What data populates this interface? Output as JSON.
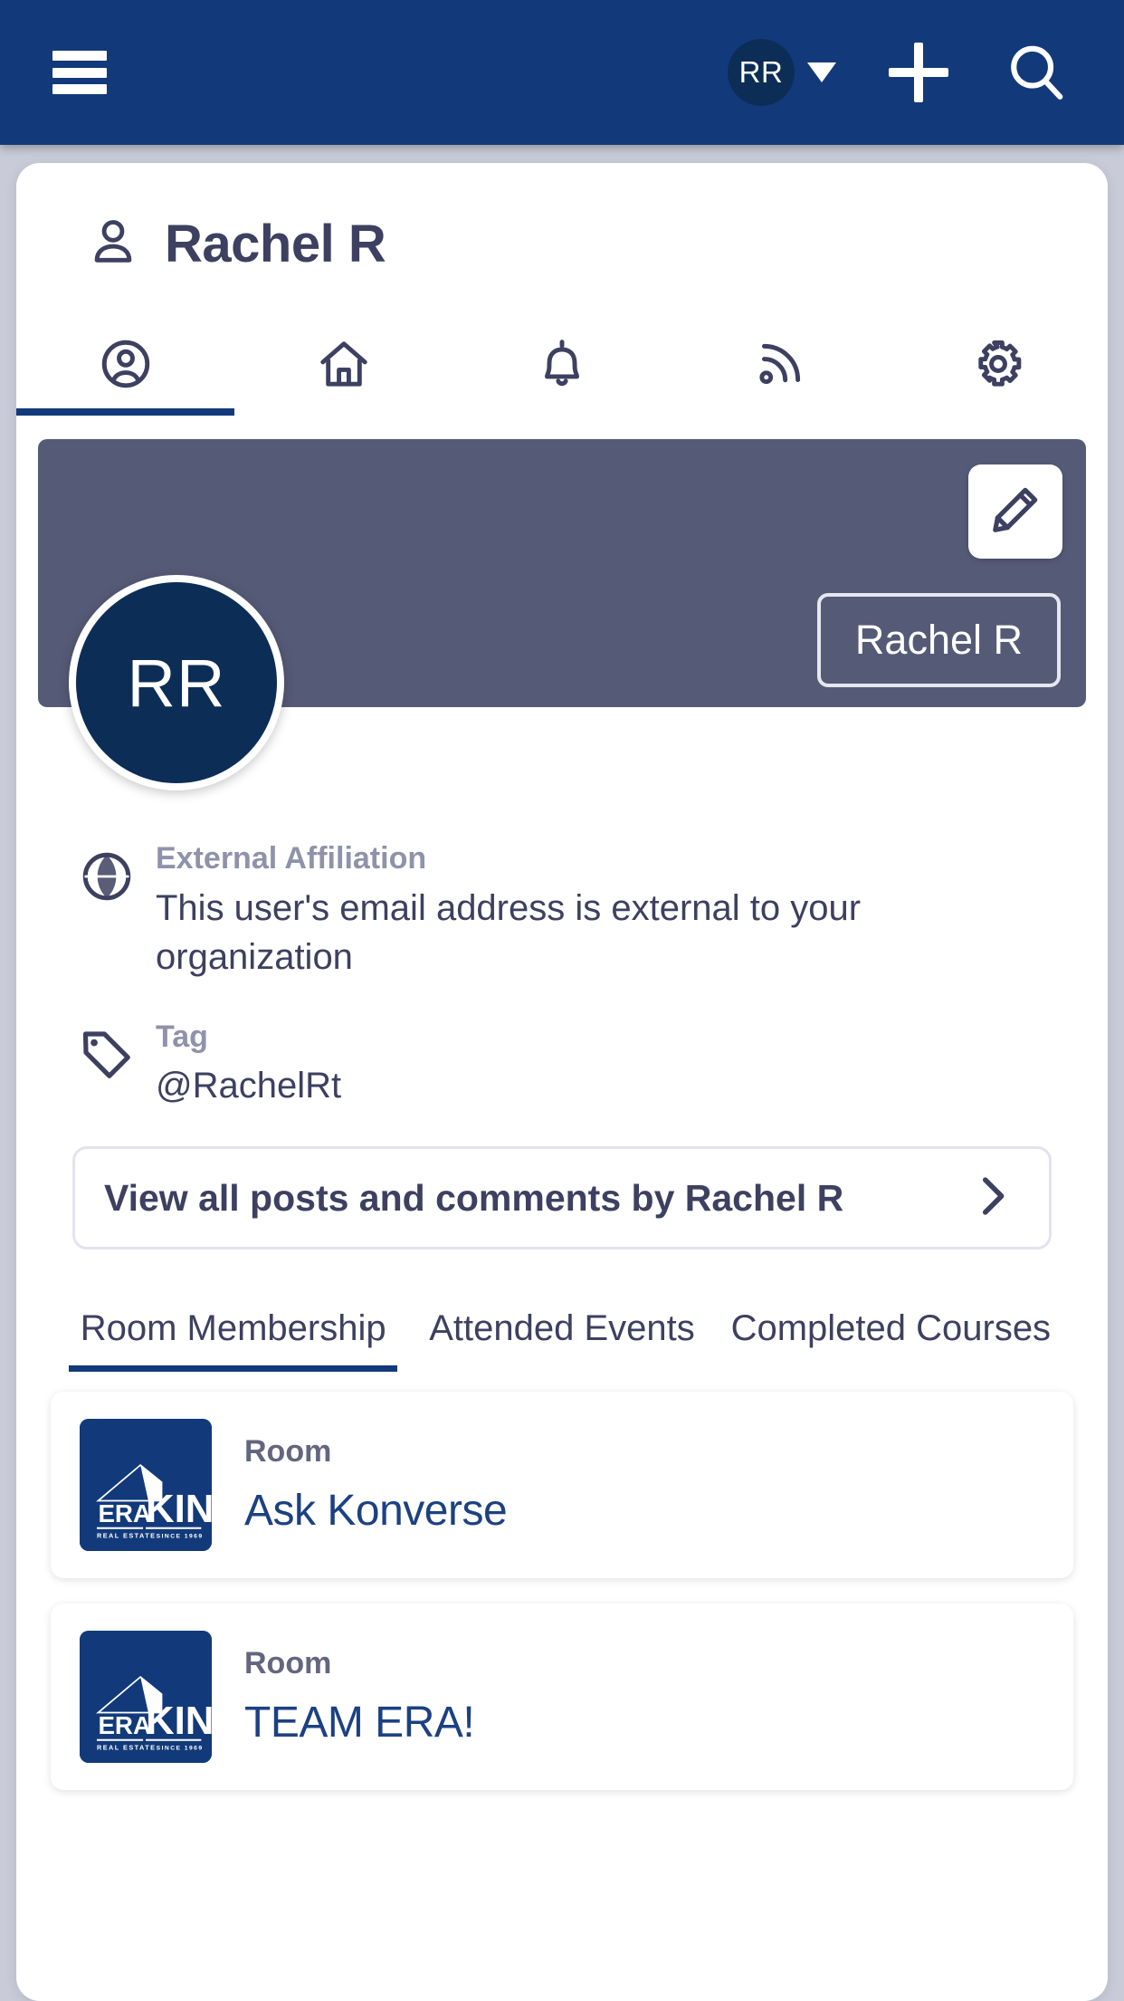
{
  "topbar": {
    "menu_icon": "hamburger-menu-icon",
    "avatar_initials": "RR",
    "caret_icon": "chevron-down-icon",
    "add_icon": "plus-icon",
    "search_icon": "search-icon"
  },
  "page": {
    "title": "Rachel R",
    "title_icon": "person-icon"
  },
  "icon_tabs": [
    {
      "name": "profile",
      "icon": "user-circle-icon",
      "active": true
    },
    {
      "name": "home",
      "icon": "home-icon",
      "active": false
    },
    {
      "name": "notifications",
      "icon": "bell-icon",
      "active": false
    },
    {
      "name": "feed",
      "icon": "rss-feed-icon",
      "active": false
    },
    {
      "name": "settings",
      "icon": "gear-icon",
      "active": false
    }
  ],
  "banner": {
    "edit_icon": "pencil-edit-icon",
    "name_badge": "Rachel R",
    "avatar_initials": "RR",
    "banner_color": "#555a77",
    "avatar_color": "#0c2d56"
  },
  "info": [
    {
      "icon": "globe-icon",
      "label": "External Affiliation",
      "value": "This user's email address is external to your organization"
    },
    {
      "icon": "tag-icon",
      "label": "Tag",
      "value": "@RachelRt"
    }
  ],
  "view_all": {
    "label": "View all posts and comments by Rachel R",
    "chevron_icon": "chevron-right-icon"
  },
  "tabs": [
    {
      "label": "Room Membership",
      "active": true
    },
    {
      "label": "Attended Events",
      "active": false
    },
    {
      "label": "Completed Courses",
      "active": false
    }
  ],
  "rooms": [
    {
      "kicker": "Room",
      "name": "Ask Konverse",
      "logo_brand": "ERA",
      "logo_brand_sub": "REAL ESTATE",
      "logo_word": "KING",
      "logo_word_sub": "SINCE 1969"
    },
    {
      "kicker": "Room",
      "name": "TEAM ERA!",
      "logo_brand": "ERA",
      "logo_brand_sub": "REAL ESTATE",
      "logo_word": "KING",
      "logo_word_sub": "SINCE 1969"
    }
  ],
  "colors": {
    "nav_blue": "#123a7a",
    "accent_navy": "#0c2d56",
    "text_slate": "#3d4060",
    "muted": "#8f92aa",
    "link_blue": "#1c4182"
  }
}
